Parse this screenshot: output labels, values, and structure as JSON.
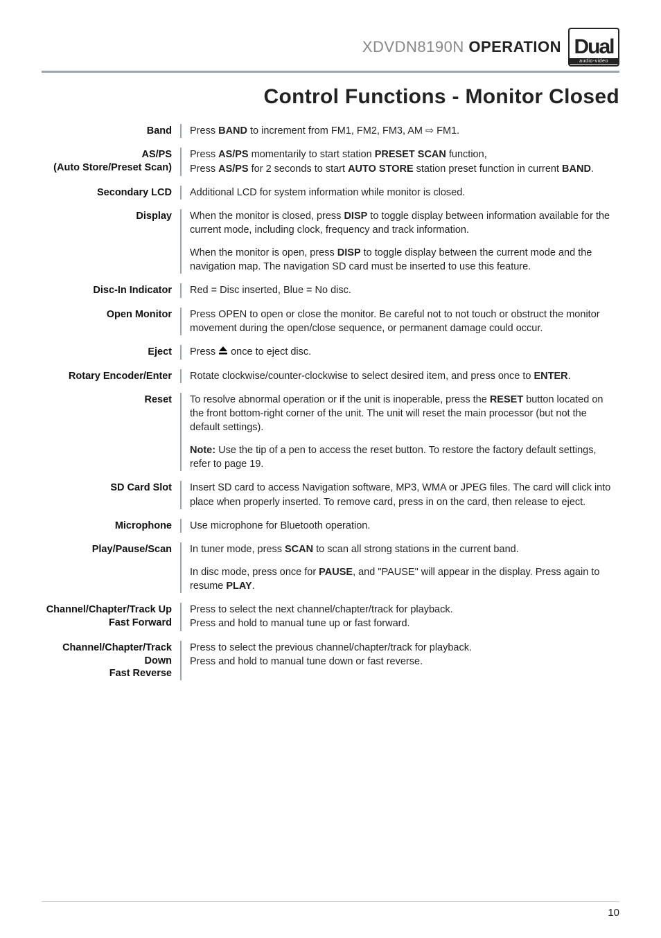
{
  "header": {
    "model": "XDVDN8190N",
    "op": "OPERATION",
    "logo_main": "Dual",
    "logo_sub": "audio-video"
  },
  "title": "Control Functions - Monitor Closed",
  "rows": [
    {
      "label": "Band",
      "paras": [
        "Press <span class=\"b\">BAND</span> to increment from FM1, FM2, FM3, AM ⇨ FM1."
      ]
    },
    {
      "label": "AS/PS<br>(Auto Store/Preset Scan)",
      "paras": [
        "Press <span class=\"b\">AS/PS</span> momentarily to start station <span class=\"b\">PRESET SCAN</span> function,<br>Press <span class=\"b\">AS/PS</span> for 2 seconds to start <span class=\"b\">AUTO STORE</span> station preset function in current <span class=\"b\">BAND</span>."
      ]
    },
    {
      "label": "Secondary LCD",
      "paras": [
        "Additional LCD for system information while monitor is closed."
      ]
    },
    {
      "label": "Display",
      "paras": [
        "When the monitor is closed, press <span class=\"b\">DISP</span> to toggle display between information available for the current mode, including clock, frequency and track information.",
        "When the monitor is open, press <span class=\"b\">DISP</span> to toggle display between the current mode and the navigation map. The navigation SD card must be inserted to use this feature."
      ]
    },
    {
      "label": "Disc-In Indicator",
      "paras": [
        "Red = Disc inserted, Blue = No disc."
      ]
    },
    {
      "label": "Open Monitor",
      "paras": [
        "Press OPEN to open or close the monitor. Be careful not to not touch or obstruct the monitor movement during the open/close sequence, or permanent damage could occur."
      ]
    },
    {
      "label": "Eject",
      "paras": [
        "Press <svg class=\"eject-svg\" viewBox=\"0 0 14 14\"><polygon points=\"7,1 13,8 1,8\" fill=\"#000\"/><rect x=\"1\" y=\"10\" width=\"12\" height=\"2.5\" fill=\"#000\"/></svg> once to eject disc."
      ]
    },
    {
      "label": "Rotary Encoder/Enter",
      "paras": [
        "Rotate clockwise/counter-clockwise to select desired item, and press once to <span class=\"b\">ENTER</span>."
      ]
    },
    {
      "label": "Reset",
      "paras": [
        "To resolve abnormal operation or if the unit is inoperable, press the <span class=\"b\">RESET</span> button located on the front bottom-right corner of the unit. The unit will reset the main processor (but not the default settings).",
        "<span class=\"b\">Note:</span> Use the tip of a pen to access the reset button. To restore the factory default settings, refer to page 19."
      ]
    },
    {
      "label": "SD Card Slot",
      "paras": [
        "Insert SD card to access Navigation software, MP3, WMA or JPEG files. The card will click into place when properly inserted. To remove card, press in on the card, then release to eject."
      ]
    },
    {
      "label": "Microphone",
      "paras": [
        "Use microphone for Bluetooth operation."
      ]
    },
    {
      "label": "Play/Pause/Scan",
      "paras": [
        "In tuner mode, press <span class=\"b\">SCAN</span> to scan all strong stations in the current band.",
        "In disc mode, press once for <span class=\"b\">PAUSE</span>, and \"PAUSE\" will appear in the display. Press again to resume <span class=\"b\">PLAY</span>."
      ]
    },
    {
      "label": "Channel/Chapter/Track Up<br>Fast Forward",
      "paras": [
        "Press to select the next channel/chapter/track for playback.<br>Press and hold to manual tune up or fast forward."
      ]
    },
    {
      "label": "Channel/Chapter/Track Down<br>Fast Reverse",
      "paras": [
        "Press to select the previous channel/chapter/track for playback.<br>Press and hold to manual tune down or fast reverse."
      ]
    }
  ],
  "page_number": "10"
}
